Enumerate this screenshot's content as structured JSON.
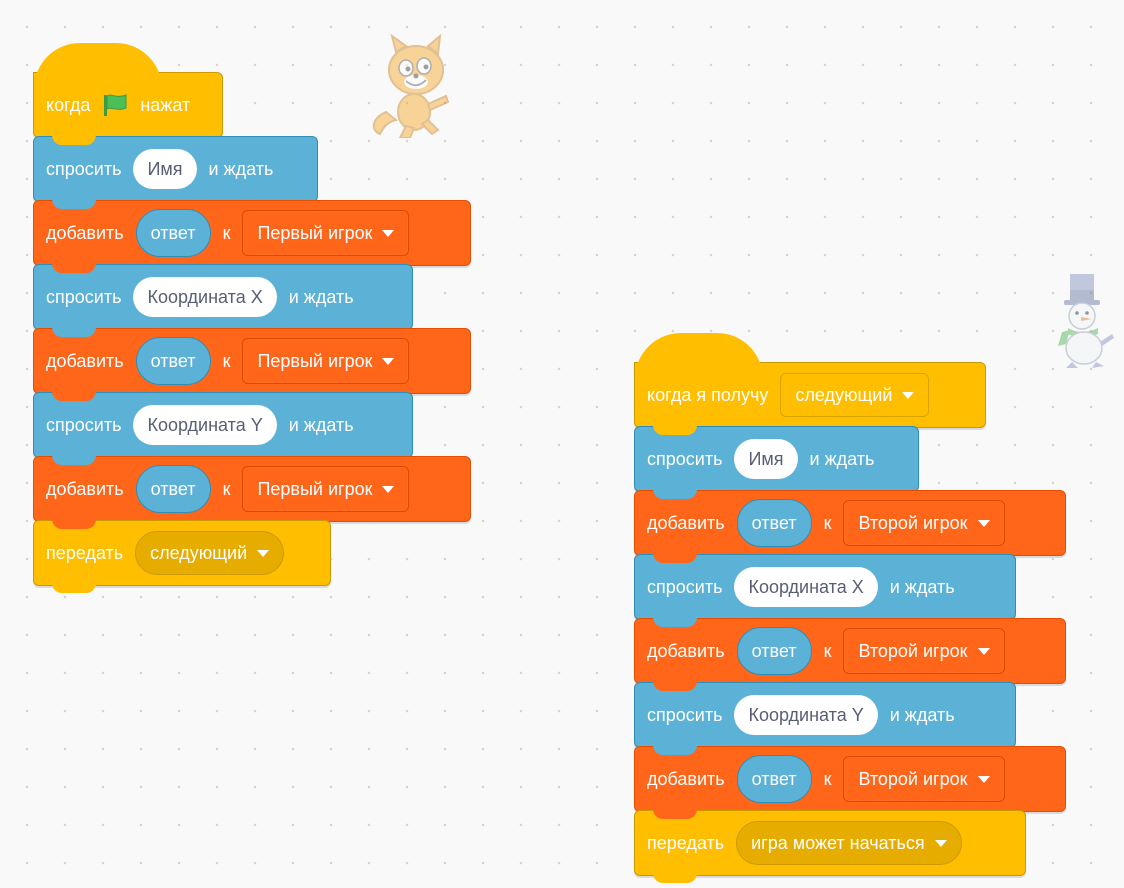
{
  "script1": {
    "hat": {
      "when": "когда",
      "flag_icon": "green-flag-icon",
      "clicked": "нажат"
    },
    "blocks": [
      {
        "type": "ask",
        "label": "спросить",
        "question": "Имя",
        "wait": "и ждать"
      },
      {
        "type": "add",
        "label": "добавить",
        "item": "ответ",
        "to": "к",
        "list": "Первый игрок"
      },
      {
        "type": "ask",
        "label": "спросить",
        "question": "Координата X",
        "wait": "и ждать"
      },
      {
        "type": "add",
        "label": "добавить",
        "item": "ответ",
        "to": "к",
        "list": "Первый игрок"
      },
      {
        "type": "ask",
        "label": "спросить",
        "question": "Координата Y",
        "wait": "и ждать"
      },
      {
        "type": "add",
        "label": "добавить",
        "item": "ответ",
        "to": "к",
        "list": "Первый игрок"
      }
    ],
    "broadcast": {
      "label": "передать",
      "message": "следующий"
    }
  },
  "script2": {
    "hat": {
      "when": "когда я получу",
      "message": "следующий"
    },
    "blocks": [
      {
        "type": "ask",
        "label": "спросить",
        "question": "Имя",
        "wait": "и ждать"
      },
      {
        "type": "add",
        "label": "добавить",
        "item": "ответ",
        "to": "к",
        "list": "Второй игрок"
      },
      {
        "type": "ask",
        "label": "спросить",
        "question": "Координата X",
        "wait": "и ждать"
      },
      {
        "type": "add",
        "label": "добавить",
        "item": "ответ",
        "to": "к",
        "list": "Второй игрок"
      },
      {
        "type": "ask",
        "label": "спросить",
        "question": "Координата Y",
        "wait": "и ждать"
      },
      {
        "type": "add",
        "label": "добавить",
        "item": "ответ",
        "to": "к",
        "list": "Второй игрок"
      }
    ],
    "broadcast": {
      "label": "передать",
      "message": "игра может начаться"
    }
  },
  "sprites": {
    "cat": "scratch-cat-sprite",
    "snowman": "snowman-sprite"
  },
  "colors": {
    "events": "#ffbf00",
    "sensing": "#5cb1d6",
    "list": "#ff661a",
    "flag": "#4cbf56"
  }
}
